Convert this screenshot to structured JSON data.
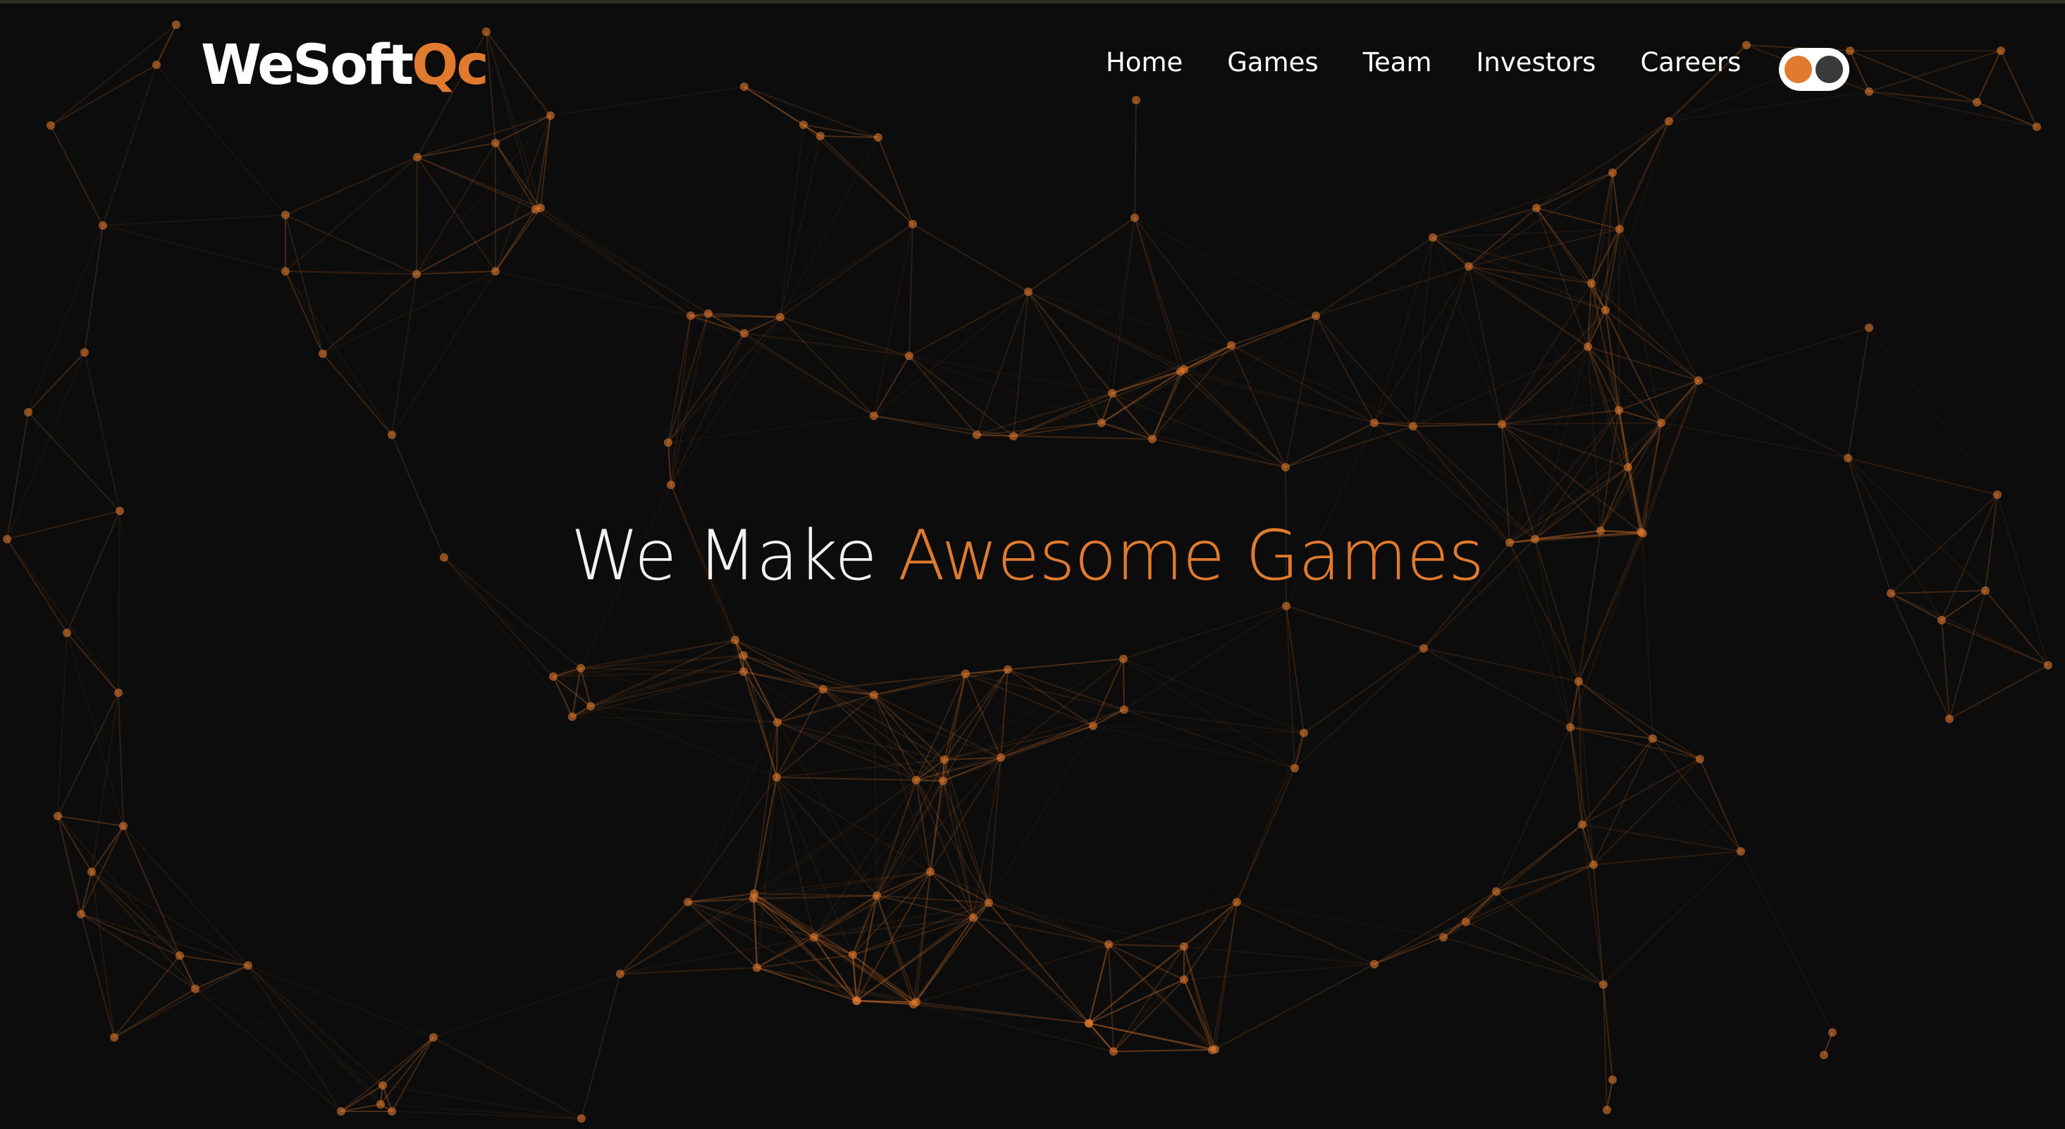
{
  "brand": {
    "part1": "WeSoft",
    "part2": "Qc"
  },
  "nav": {
    "items": [
      {
        "label": "Home"
      },
      {
        "label": "Games"
      },
      {
        "label": "Team"
      },
      {
        "label": "Investors"
      },
      {
        "label": "Careers"
      }
    ]
  },
  "theme_toggle": {
    "icon": "theme-toggle"
  },
  "hero": {
    "title_part1": "We Make ",
    "title_part2": "Awesome Games"
  },
  "colors": {
    "accent": "#e07a2e",
    "background": "#0c0c0c",
    "text": "#ffffff",
    "network": "#e07a2e"
  }
}
